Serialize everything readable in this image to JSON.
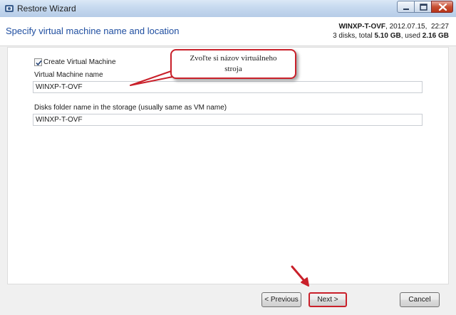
{
  "window": {
    "title": "Restore Wizard"
  },
  "header": {
    "title": "Specify virtual machine name and location",
    "vm_name": "WINXP-T-OVF",
    "date": ", 2012.07.15,",
    "time": "22:27",
    "disks_text": "3 disks, total",
    "total_size": "5.10 GB",
    "used_text": ", used",
    "used_size": "2.16 GB"
  },
  "form": {
    "create_vm_label": "Create Virtual Machine",
    "create_vm_checked": true,
    "vm_name_label": "Virtual Machine name",
    "vm_name_value": "WINXP-T-OVF",
    "disks_folder_label": "Disks folder name in the storage (usually same as VM name)",
    "disks_folder_value": "WINXP-T-OVF"
  },
  "callout": {
    "line1": "Zvoľte si názov virtuálneho",
    "line2": "stroja",
    "color": "#c9202a"
  },
  "buttons": {
    "previous": "< Previous",
    "next": "Next >",
    "cancel": "Cancel"
  },
  "icons": {
    "app": "restore-wizard-icon",
    "minimize": "minimize-icon",
    "maximize": "maximize-icon",
    "close": "close-icon",
    "check": "checkmark-icon",
    "arrow": "pointer-arrow-icon"
  }
}
